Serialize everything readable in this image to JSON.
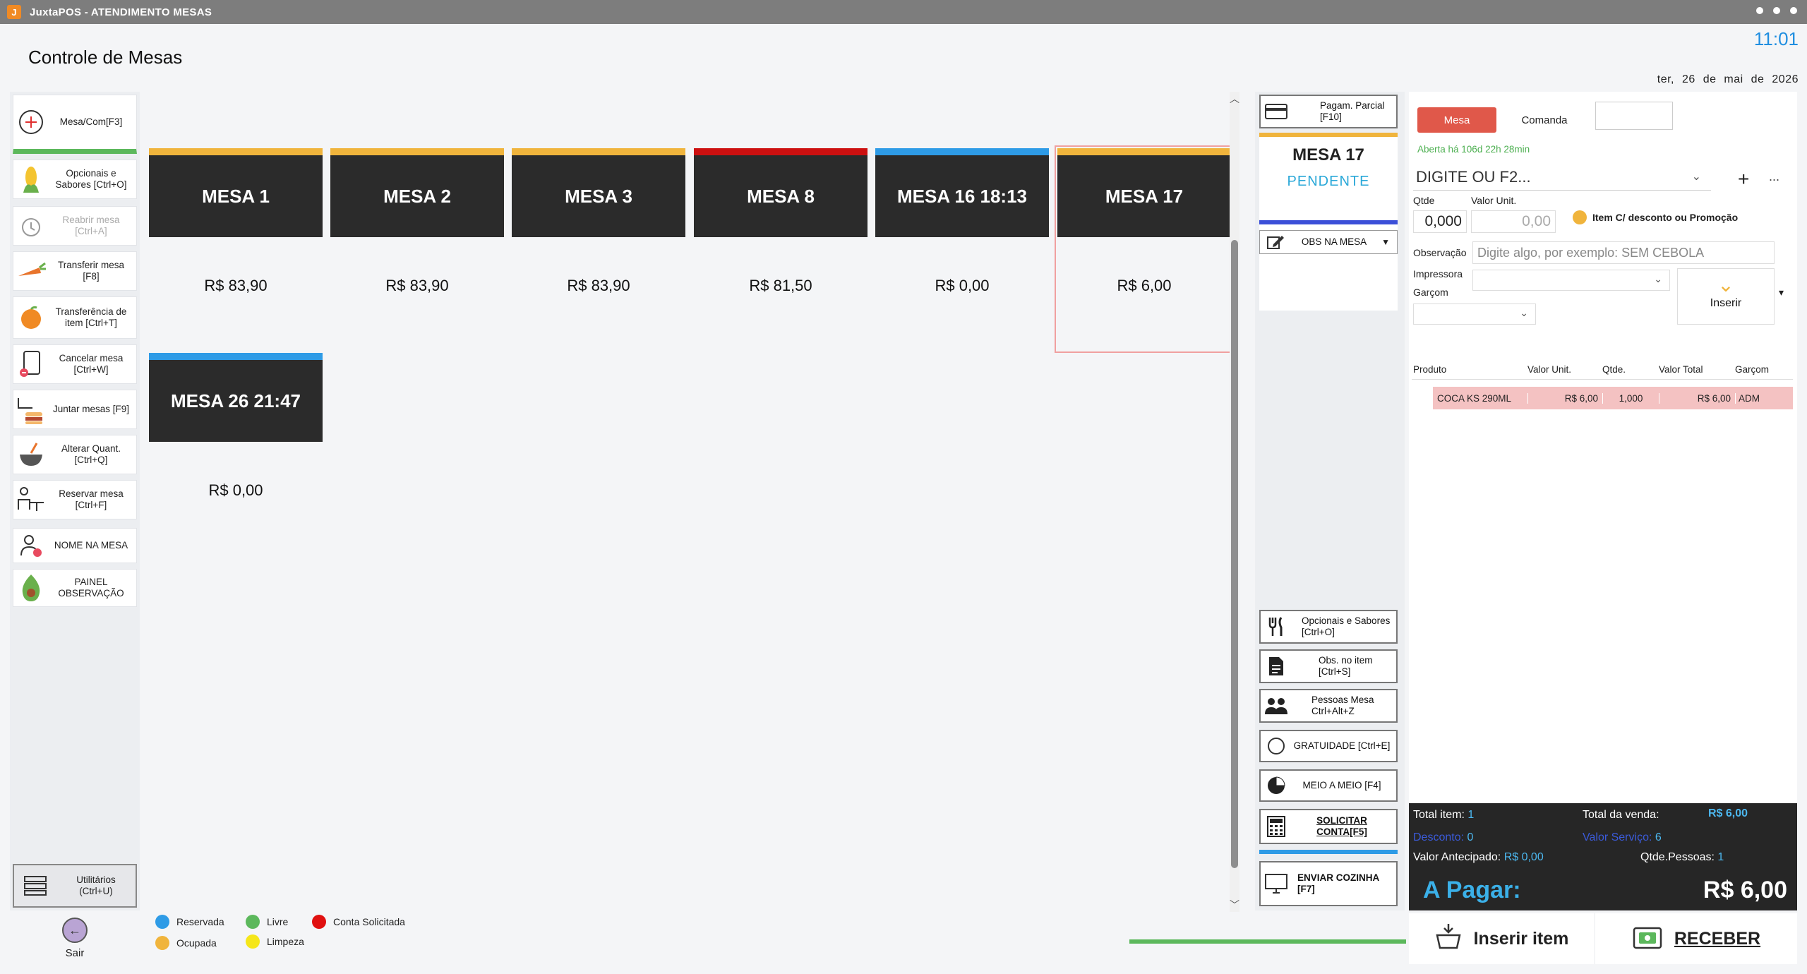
{
  "window": {
    "title": "JuxtaPOS - ATENDIMENTO MESAS"
  },
  "header": {
    "title": "Controle de Mesas",
    "clock": "11:01",
    "date": "ter, 26 de mai de 2026"
  },
  "sidebar": {
    "items": [
      {
        "label": "Mesa/Com[F3]",
        "icon": "plus-circle-icon"
      },
      {
        "label": "Opcionais e Sabores [Ctrl+O]",
        "icon": "corn-icon"
      },
      {
        "label": "Reabrir mesa [Ctrl+A]",
        "icon": "alarm-clock-icon",
        "disabled": true
      },
      {
        "label": "Transferir mesa [F8]",
        "icon": "carrot-icon"
      },
      {
        "label": "Transferência de item [Ctrl+T]",
        "icon": "orange-icon"
      },
      {
        "label": "Cancelar mesa [Ctrl+W]",
        "icon": "cancel-doc-icon"
      },
      {
        "label": "Juntar mesas [F9]",
        "icon": "merge-food-icon"
      },
      {
        "label": "Alterar Quant. [Ctrl+Q]",
        "icon": "bowl-icon"
      },
      {
        "label": "Reservar mesa [Ctrl+F]",
        "icon": "reserve-icon"
      },
      {
        "label": "NOME NA MESA",
        "icon": "user-add-icon"
      },
      {
        "label": "PAINEL OBSERVAÇÃO",
        "icon": "avocado-icon"
      }
    ],
    "utilities": "Utilitários (Ctrl+U)",
    "exit": "Sair"
  },
  "legend": [
    {
      "label": "Reservada",
      "color": "#2e9be6"
    },
    {
      "label": "Livre",
      "color": "#5cb85c"
    },
    {
      "label": "Conta Solicitada",
      "color": "#e01010"
    },
    {
      "label": "Ocupada",
      "color": "#f0b43c"
    },
    {
      "label": "Limpeza",
      "color": "#f5e61a"
    }
  ],
  "mesas": [
    {
      "name": "MESA 1",
      "price": "R$ 83,90",
      "color": "#f0b43c"
    },
    {
      "name": "MESA 2",
      "price": "R$ 83,90",
      "color": "#f0b43c"
    },
    {
      "name": "MESA 3",
      "price": "R$ 83,90",
      "color": "#f0b43c"
    },
    {
      "name": "MESA 8",
      "price": "R$ 81,50",
      "color": "#cc1010"
    },
    {
      "name": "MESA 16 18:13",
      "price": "R$ 0,00",
      "color": "#2e9be6"
    },
    {
      "name": "MESA 17",
      "price": "R$ 6,00",
      "color": "#f0b43c",
      "selected": true
    },
    {
      "name": "MESA 26 21:47",
      "price": "R$ 0,00",
      "color": "#2e9be6"
    }
  ],
  "middle": {
    "pagamento": "Pagam. Parcial [F10]",
    "selected_mesa": "MESA 17",
    "selected_status": "PENDENTE",
    "obs_mesa": "OBS NA MESA",
    "actions": [
      {
        "label": "Opcionais e Sabores [Ctrl+O]",
        "icon": "fork-knife-icon"
      },
      {
        "label": "Obs. no item [Ctrl+S]",
        "icon": "document-icon"
      },
      {
        "label": "Pessoas Mesa Ctrl+Alt+Z",
        "icon": "people-icon"
      },
      {
        "label": "GRATUIDADE [Ctrl+E]",
        "icon": "circle-icon"
      },
      {
        "label": "MEIO A MEIO [F4]",
        "icon": "pie-icon"
      },
      {
        "label": "SOLICITAR CONTA[F5]",
        "icon": "calculator-icon"
      }
    ],
    "enviar": "ENVIAR COZINHA [F7]"
  },
  "order": {
    "tab_mesa": "Mesa",
    "tab_comanda": "Comanda",
    "aberta": "Aberta há 106d 22h 28min",
    "produto_placeholder": "DIGITE OU F2...",
    "qtde_label": "Qtde",
    "qtde_value": "0,000",
    "valor_unit_label": "Valor Unit.",
    "valor_unit_value": "0,00",
    "promo_label": "Item C/ desconto ou Promoção",
    "obs_label": "Observação",
    "obs_placeholder": "Digite algo, por exemplo: SEM CEBOLA",
    "impressora_label": "Impressora",
    "garcom_label": "Garçom",
    "inserir_label": "Inserir",
    "columns": [
      "Produto",
      "Valor Unit.",
      "Qtde.",
      "Valor Total",
      "Garçom"
    ],
    "rows": [
      {
        "produto": "COCA KS 290ML",
        "valor_unit": "R$ 6,00",
        "qtde": "1,000",
        "valor_total": "R$ 6,00",
        "garcom": "ADM"
      }
    ]
  },
  "totals": {
    "total_item_label": "Total item:",
    "total_item": "1",
    "total_venda_label": "Total da venda:",
    "total_venda": "R$ 6,00",
    "desconto_label": "Desconto:",
    "desconto": "0",
    "servico_label": "Valor Serviço:",
    "servico": "6",
    "antecipado_label": "Valor Antecipado:",
    "antecipado": "R$ 0,00",
    "pessoas_label": "Qtde.Pessoas:",
    "pessoas": "1",
    "apagar_label": "A Pagar:",
    "apagar": "R$ 6,00"
  },
  "bottom": {
    "inserir": "Inserir item",
    "receber": "RECEBER"
  }
}
